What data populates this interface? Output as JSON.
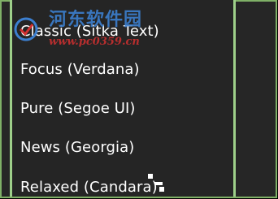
{
  "menu": {
    "items": [
      {
        "label": "Classic (Sitka Text)"
      },
      {
        "label": "Focus (Verdana)"
      },
      {
        "label": "Pure (Segoe UI)"
      },
      {
        "label": "News (Georgia)"
      },
      {
        "label": "Relaxed (Candara)"
      }
    ]
  },
  "watermark": {
    "text_cn": "河东软件园",
    "url": "www.pc0359.cn",
    "icon": "watermark-logo-icon"
  },
  "colors": {
    "panel_bg": "#252525",
    "border": "#9ed08a",
    "text": "#ffffff"
  }
}
